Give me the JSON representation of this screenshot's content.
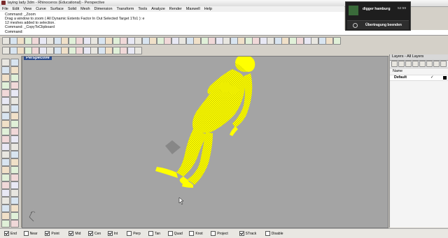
{
  "window": {
    "title": "laying lady 3dm - Rhinoceros (Educational) - Perspective"
  },
  "menu": [
    "File",
    "Edit",
    "View",
    "Curve",
    "Surface",
    "Solid",
    "Mesh",
    "Dimension",
    "Transform",
    "Tools",
    "Analyze",
    "Render",
    "Maxwell",
    "Help"
  ],
  "command_history": [
    "Command: _Zoom",
    "Drag a window to zoom ( All Dynamic Extents Factor In Out Selected Target 1To1 ): e",
    "12 meshes added to selection.",
    "Command: _CopyToClipboard"
  ],
  "command_prompt": "Command:",
  "viewport": {
    "label": "Perspective",
    "model_color": "#ffff00",
    "background": "#a4a4a4"
  },
  "layers_panel": {
    "title": "Layers - All Layers",
    "column_header": "Name",
    "layers": [
      {
        "name": "Default",
        "current": "✓",
        "color": "#000000"
      }
    ]
  },
  "osnaps": [
    {
      "label": "End",
      "checked": true
    },
    {
      "label": "Near",
      "checked": false
    },
    {
      "label": "Point",
      "checked": true
    },
    {
      "label": "Mid",
      "checked": true
    },
    {
      "label": "Cen",
      "checked": true
    },
    {
      "label": "Int",
      "checked": true
    },
    {
      "label": "Perp",
      "checked": false
    },
    {
      "label": "Tan",
      "checked": false
    },
    {
      "label": "Quad",
      "checked": false
    },
    {
      "label": "Knot",
      "checked": false
    },
    {
      "label": "Project",
      "checked": false
    },
    {
      "label": "STrack",
      "checked": true
    },
    {
      "label": "Disable",
      "checked": false
    }
  ],
  "notification": {
    "user": "digger hamburg",
    "time": "52:59",
    "action_label": "Übertragung beenden"
  },
  "icons": {
    "toolbar": "toolbar-icon",
    "left_toolbar": "tool-icon",
    "cursor": "mouse-cursor-icon",
    "axis": "world-axis-icon"
  }
}
